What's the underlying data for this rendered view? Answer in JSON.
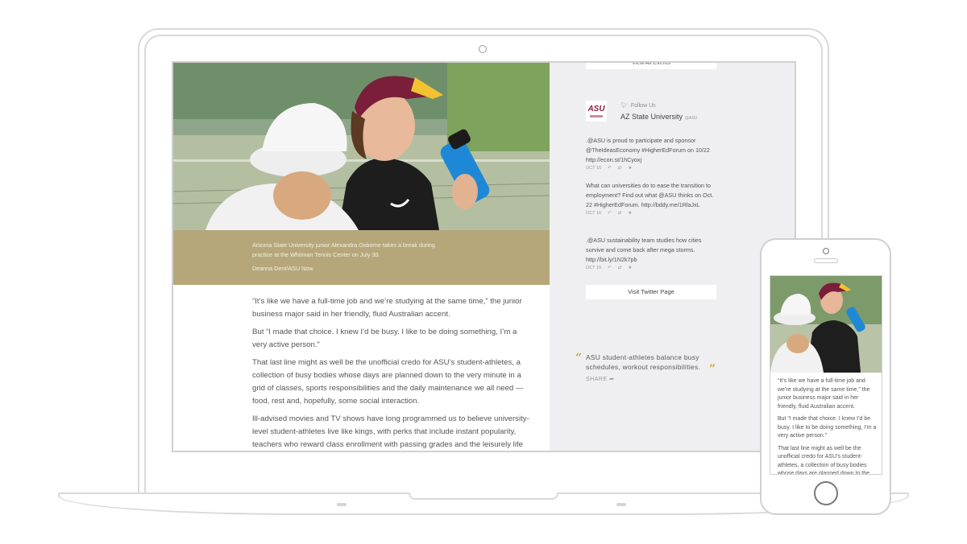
{
  "article": {
    "caption": "Arizona State University junior Alexandra Osborne takes a break during practice at the Whitman Tennis Center on July 30.",
    "credit": "Deanna Dent/ASU Now",
    "paragraphs": [
      "“It’s like we have a full-time job and we’re studying at the same time,” the junior business major said in her friendly, fluid Australian accent.",
      "But “I made that choice. I knew I’d be busy. I like to be doing something, I’m a very active person.”",
      "That last line might as well be the unofficial credo for ASU’s student-athletes, a collection of busy bodies whose days are planned down to the very minute in a grid of classes, sports responsibilities and the daily maintenance we all need — food, rest and, hopefully, some social interaction.",
      "Ill-advised movies and TV shows have long programmed us to believe university-level student-athletes live like kings, with perks that include instant popularity, teachers who reward class enrollment with passing grades and the leisurely life of, well, royalty."
    ]
  },
  "sidebar": {
    "events_button": "View All Events",
    "follow_label": "Follow Us",
    "account_name": "AZ State University",
    "account_handle": "@ASU",
    "logo_text": "ASU",
    "tweets": [
      {
        "text": ".@ASU is proud to participate and sponsor @TheIdeasEconomy #HigherEdForum on 10/22 http://econ.st/1hCyoxj",
        "date": "OCT 16"
      },
      {
        "text": "What can universities do to ease the transition to employment? Find out what @ASU thinks on Oct. 22 #HigherEdForum. http://bddy.me/1RlaJxL",
        "date": "OCT 16"
      },
      {
        "text": ".@ASU sustainability team studies how cities survive and come back after mega storms. http://bit.ly/1N2k7pb",
        "date": "OCT 16"
      }
    ],
    "twitter_button": "Visit Twitter Page",
    "pull_quote": "ASU student-athletes balance busy schedules, workout responsibilities.",
    "share_label": "SHARE"
  },
  "phone": {
    "paragraphs": [
      "“It’s like we have a full-time job and we’re studying at the same time,” the junior business major said in her friendly, fluid Australian accent.",
      "But “I made that choice. I knew I’d be busy. I like to be doing something, I’m a very active person.”",
      "That last line might as well be the unofficial credo for ASU’s student-athletes, a collection of busy bodies whose days are planned down to the very minute"
    ]
  },
  "colors": {
    "caption_band": "#b5a77a",
    "asu_maroon": "#8c1d40",
    "asu_gold": "#d4a62a",
    "sidebar_bg": "#efeff1"
  }
}
